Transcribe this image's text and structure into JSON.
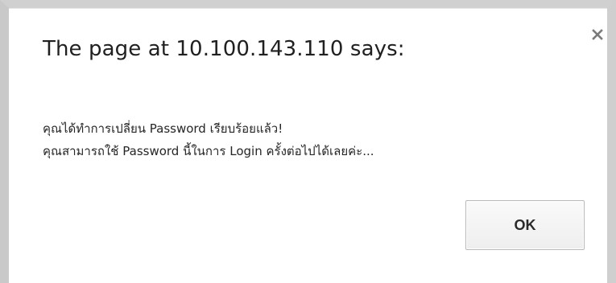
{
  "dialog": {
    "title": "The page at 10.100.143.110 says:",
    "close_icon": "close-icon",
    "message_lines": [
      "คุณได้ทำการเปลี่ยน Password เรียบร้อยแล้ว!",
      "คุณสามารถใช้ Password นี้ในการ Login ครั้งต่อไปได้เลยค่ะ..."
    ],
    "ok_label": "OK"
  },
  "colors": {
    "frame": "#c9c9c9",
    "background": "#ffffff",
    "text": "#222222",
    "button_border": "#b9b9b9"
  }
}
